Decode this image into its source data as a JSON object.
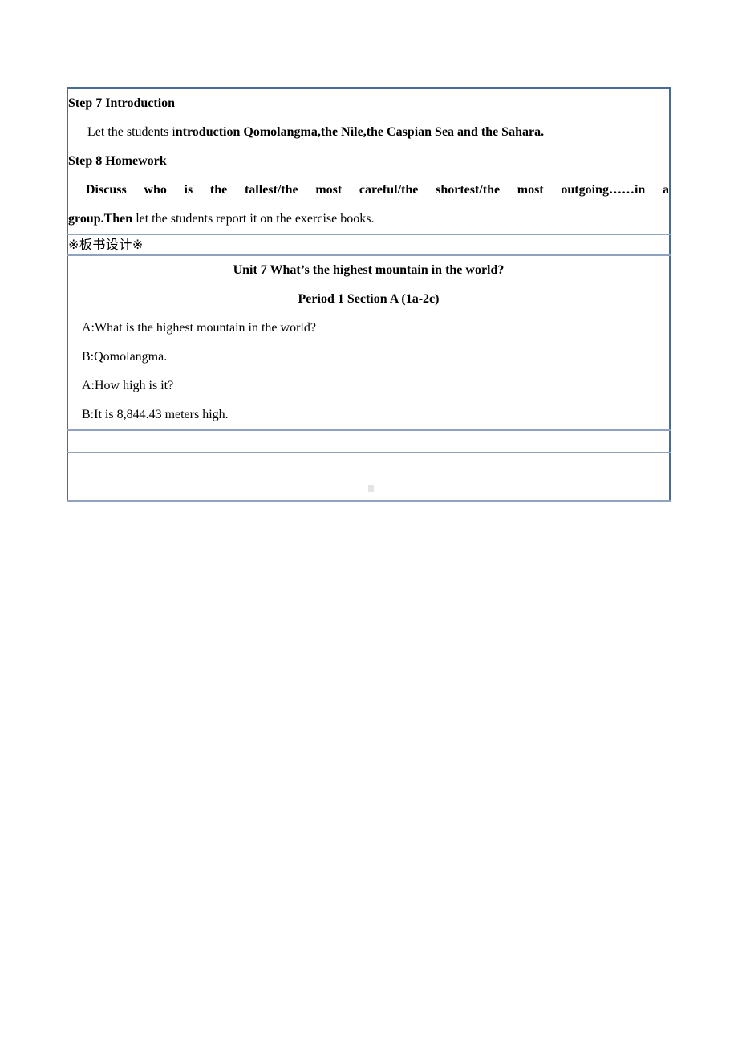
{
  "document": {
    "type": "lesson-plan",
    "language": "en-zh",
    "colors": {
      "border_outer": "#4a6a94",
      "border_inner": "#8fa3bf",
      "page_background": "#ffffff",
      "text": "#000000",
      "placeholder_glyph": "#e4e4e4"
    }
  },
  "steps_section": {
    "step7_heading": "Step 7 Introduction",
    "step7_line": {
      "regular_prefix": "Let the students i",
      "bold_rest": "ntroduction Qomolangma,the Nile,the Caspian Sea and the Sahara."
    },
    "step8_heading": "Step 8 Homework",
    "step8_line_justified": "Discuss who is the tallest/the most careful/the shortest/the most outgoing……in a",
    "step8_line_wrap": {
      "bold_prefix": "group.Then",
      "regular_rest": " let the students report it on the exercise books."
    }
  },
  "banshu_section": {
    "heading": "※板书设计※"
  },
  "board_section": {
    "title_line1": "Unit 7 What’s the highest mountain in the world?",
    "title_line2": "Period 1 Section A (1a-2c)",
    "dialogue": [
      "A:What is the highest mountain in the world?",
      "B:Qomolangma.",
      "A:How high is it?",
      "B:It is 8,844.43 meters high."
    ]
  },
  "blank_rows": [
    {
      "content": ""
    },
    {
      "content": ""
    }
  ]
}
